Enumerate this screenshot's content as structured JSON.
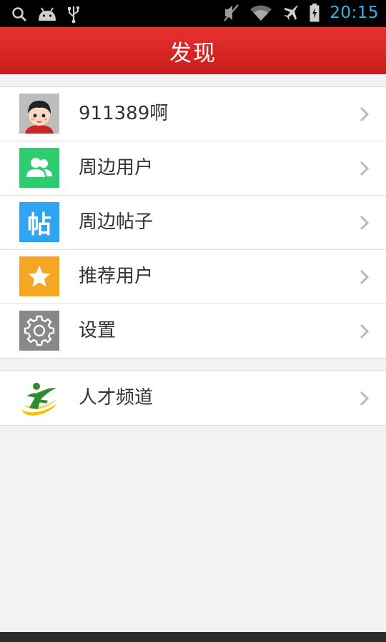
{
  "status_bar": {
    "time": "20:15",
    "icons": [
      "search-icon",
      "android-icon",
      "usb-icon",
      "mute-icon",
      "wifi-icon",
      "airplane-mode-icon",
      "battery-charging-icon"
    ],
    "time_color": "#33b5e5"
  },
  "header": {
    "title": "发现",
    "color": "#d9272a"
  },
  "menu_group_1": [
    {
      "label": "911389啊",
      "icon": "user-avatar-icon"
    },
    {
      "label": "周边用户",
      "icon": "nearby-users-icon",
      "color": "#2ecc71"
    },
    {
      "label": "周边帖子",
      "icon": "nearby-posts-icon",
      "icon_text": "帖",
      "color": "#2fa5f2"
    },
    {
      "label": "推荐用户",
      "icon": "star-icon",
      "color": "#f5a623"
    },
    {
      "label": "设置",
      "icon": "gear-icon",
      "color": "#8a8886"
    }
  ],
  "menu_group_2": [
    {
      "label": "人才频道",
      "icon": "talent-channel-logo-icon"
    }
  ]
}
